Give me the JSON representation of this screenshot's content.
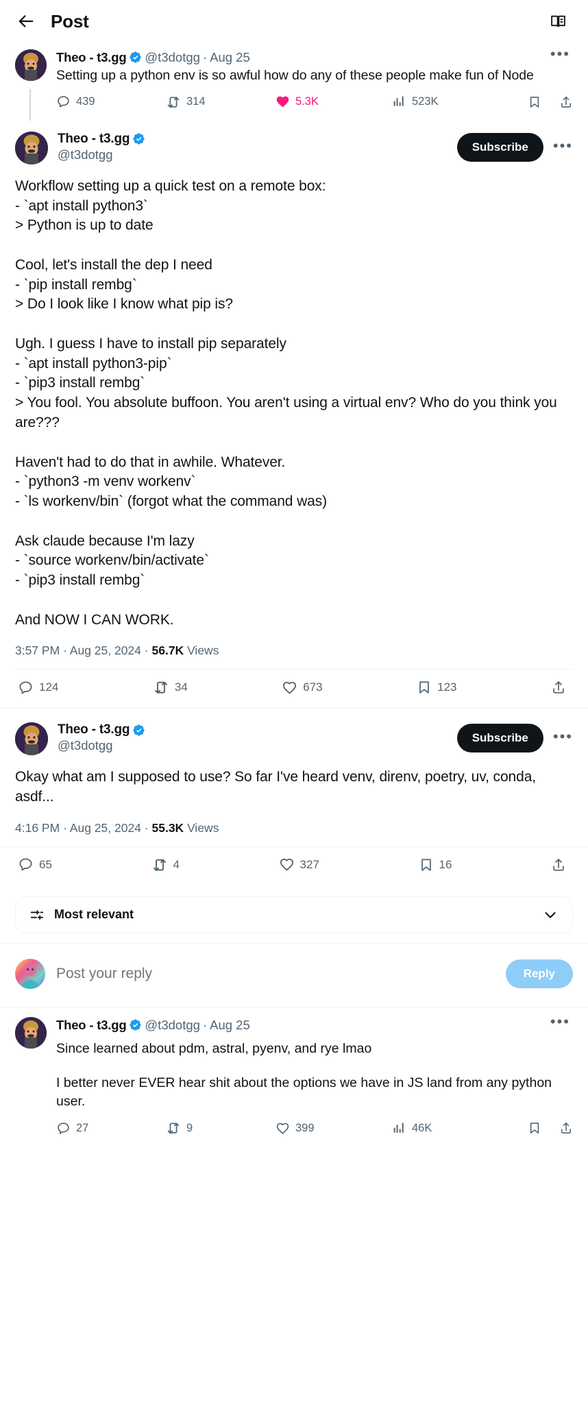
{
  "header": {
    "back_label": "Back",
    "title": "Post",
    "reader_label": "Reader"
  },
  "author": {
    "display_name": "Theo - t3.gg",
    "handle": "@t3dotgg",
    "verified": true
  },
  "parent_tweet": {
    "display_name": "Theo - t3.gg",
    "handle": "@t3dotgg",
    "separator": "·",
    "date": "Aug 25",
    "text": "Setting up a python env is so awful how do any of these people make fun of Node",
    "more_label": "More",
    "actions": {
      "replies": "439",
      "reposts": "314",
      "likes": "5.3K",
      "views": "523K",
      "liked": true,
      "bookmark_label": "",
      "share_label": ""
    }
  },
  "focal_tweet": {
    "display_name": "Theo - t3.gg",
    "handle": "@t3dotgg",
    "subscribe_label": "Subscribe",
    "more_label": "More",
    "text": "Workflow setting up a quick test on a remote box:\n- `apt install python3`\n> Python is up to date\n\nCool, let's install the dep I need\n- `pip install rembg`\n> Do I look like I know what pip is?\n\nUgh. I guess I have to install pip separately\n- `apt install python3-pip`\n- `pip3 install rembg`\n> You fool. You absolute buffoon. You aren't using a virtual env? Who do you think you are???\n\nHaven't had to do that in awhile. Whatever.\n- `python3 -m venv workenv`\n- `ls workenv/bin` (forgot what the command was)\n\nAsk claude because I'm lazy\n- `source workenv/bin/activate`\n- `pip3 install rembg`\n\nAnd NOW I CAN WORK.",
    "time": "3:57 PM",
    "sep1": "·",
    "date": "Aug 25, 2024",
    "sep2": "·",
    "views_count": "56.7K",
    "views_label": "Views",
    "actions": {
      "replies": "124",
      "reposts": "34",
      "likes": "673",
      "bookmarks": "123",
      "liked": false
    }
  },
  "second_tweet": {
    "display_name": "Theo - t3.gg",
    "handle": "@t3dotgg",
    "subscribe_label": "Subscribe",
    "more_label": "More",
    "text": "Okay what am I supposed to use? So far I've heard venv, direnv, poetry, uv, conda, asdf...",
    "time": "4:16 PM",
    "sep1": "·",
    "date": "Aug 25, 2024",
    "sep2": "·",
    "views_count": "55.3K",
    "views_label": "Views",
    "actions": {
      "replies": "65",
      "reposts": "4",
      "likes": "327",
      "bookmarks": "16",
      "liked": false
    }
  },
  "sort": {
    "label": "Most relevant"
  },
  "composer": {
    "placeholder": "Post your reply",
    "reply_label": "Reply"
  },
  "reply_tweet": {
    "display_name": "Theo - t3.gg",
    "handle": "@t3dotgg",
    "separator": "·",
    "date": "Aug 25",
    "more_label": "More",
    "text_line1": "Since learned about pdm, astral, pyenv, and rye lmao",
    "text_line2": "I better never EVER hear shit about the options we have in JS land from any python user.",
    "actions": {
      "replies": "27",
      "reposts": "9",
      "likes": "399",
      "views": "46K",
      "liked": false
    }
  },
  "colors": {
    "verified_blue": "#1d9bf0",
    "like_pink": "#f91880",
    "muted": "#536471",
    "text": "#0f1419",
    "border": "#eff3f4",
    "reply_btn": "#8ecdf8"
  }
}
